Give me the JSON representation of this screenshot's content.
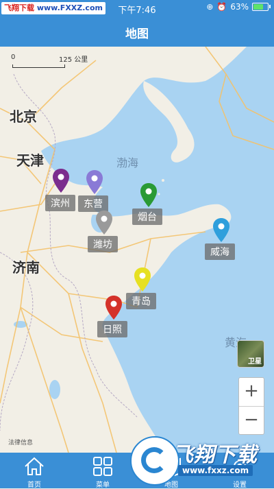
{
  "statusbar": {
    "watermark_red": "飞翔下载",
    "watermark_url": "www.FXXZ.com",
    "time": "下午7:46",
    "battery": "63%",
    "battery_level": 0.63
  },
  "navbar": {
    "title": "地图"
  },
  "map": {
    "scale": {
      "start": "0",
      "end": "125 公里"
    },
    "cities": [
      {
        "name": "北京"
      },
      {
        "name": "天津"
      },
      {
        "name": "济南"
      }
    ],
    "seas": [
      {
        "name": "渤海"
      },
      {
        "name": "黄海"
      }
    ],
    "markers": [
      {
        "label": "滨州",
        "color": "#7b2d8e"
      },
      {
        "label": "东营",
        "color": "#8a7ad6"
      },
      {
        "label": "烟台",
        "color": "#2a9a35"
      },
      {
        "label": "潍坊",
        "color": "#9a9a9a"
      },
      {
        "label": "威海",
        "color": "#2f9fdc"
      },
      {
        "label": "青岛",
        "color": "#e6e022"
      },
      {
        "label": "日照",
        "color": "#d4322a"
      }
    ],
    "satellite_label": "卫星",
    "zoom_in": "+",
    "zoom_out": "−",
    "credit": "法律信息"
  },
  "tabs": [
    {
      "label": "首页",
      "icon": "home-icon"
    },
    {
      "label": "菜单",
      "icon": "grid-icon"
    },
    {
      "label": "地图",
      "icon": "map-icon"
    },
    {
      "label": "设置",
      "icon": "gear-icon"
    }
  ],
  "banner": {
    "title": "飞翔下载",
    "url": "www.fxxz.com"
  },
  "colors": {
    "primary": "#3a8fd6",
    "sea": "#a9d3f2",
    "land": "#f2efe6"
  }
}
